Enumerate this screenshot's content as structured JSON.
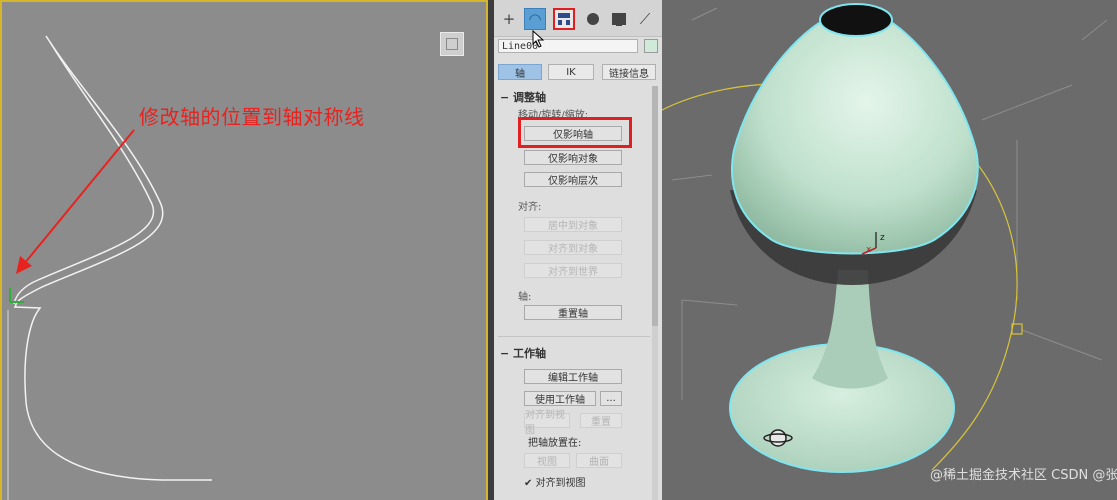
{
  "annotation": {
    "text": "修改轴的位置到轴对称线",
    "color": "#e8231f"
  },
  "command_panel": {
    "tabs": [
      {
        "name": "create",
        "icon": "plus-icon"
      },
      {
        "name": "modify",
        "icon": "modify-icon",
        "active": false
      },
      {
        "name": "hierarchy",
        "icon": "hierarchy-icon",
        "active": true
      },
      {
        "name": "motion",
        "icon": "circle-icon"
      },
      {
        "name": "display",
        "icon": "monitor-icon"
      },
      {
        "name": "utilities",
        "icon": "wrench-icon"
      }
    ],
    "object_name": "Line00",
    "object_color": "#cfead8",
    "subtabs": [
      "轴",
      "IK",
      "链接信息"
    ],
    "adjust_pivot": {
      "title": "调整轴",
      "move_rotate_scale_label": "移动/旋转/缩放:",
      "affect_pivot_only": "仅影响轴",
      "affect_object_only": "仅影响对象",
      "affect_hierarchy_only": "仅影响层次",
      "alignment_label": "对齐:",
      "center_to_object": "居中到对象",
      "align_to_object": "对齐到对象",
      "align_to_world": "对齐到世界",
      "pivot_label": "轴:",
      "reset_pivot": "重置轴"
    },
    "working_pivot": {
      "title": "工作轴",
      "edit_working_pivot": "编辑工作轴",
      "use_working_pivot": "使用工作轴",
      "more": "...",
      "align_to_view": "对齐到视图",
      "reset": "重置",
      "place_pivot_to": "把轴放置在:",
      "view": "视图",
      "surface": "曲面",
      "align_to_view_checkbox": "对齐到视图"
    }
  },
  "watermark": "@稀土掘金技术社区 CSDN @张时贰",
  "colors": {
    "highlight": "#e02020",
    "selection_edge": "#7fe6f0",
    "object_fill": "#c9e8d6",
    "viewport_border": "#d4b52c"
  }
}
